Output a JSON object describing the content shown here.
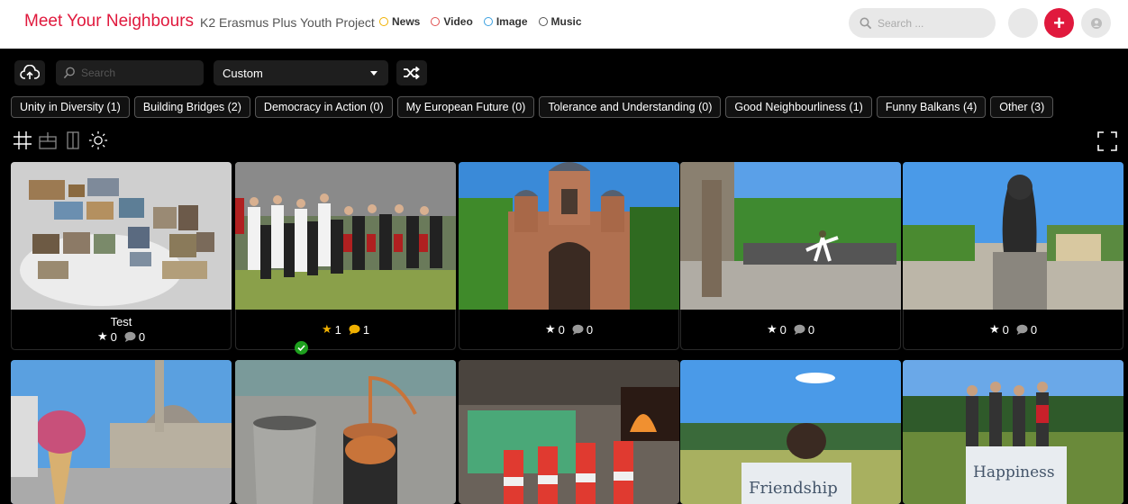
{
  "header": {
    "brand": "Meet Your Neighbours",
    "subtitle": "K2 Erasmus Plus Youth Project",
    "filters": [
      {
        "label": "News",
        "color": "#f0b000"
      },
      {
        "label": "Video",
        "color": "#e05050"
      },
      {
        "label": "Image",
        "color": "#3aa0e0"
      },
      {
        "label": "Music",
        "color": "#555555"
      }
    ],
    "search_placeholder": "Search ...",
    "add_icon": "plus-icon",
    "accent": "#e0193d"
  },
  "toolbar": {
    "search_placeholder": "Search",
    "sort_value": "Custom"
  },
  "categories": [
    "Unity in Diversity (1)",
    "Building Bridges (2)",
    "Democracy in Action (0)",
    "My European Future (0)",
    "Tolerance and Understanding (0)",
    "Good Neighbourliness (1)",
    "Funny Balkans (4)",
    "Other (3)"
  ],
  "cards": [
    {
      "title": "Test",
      "stars": "0",
      "comments": "0",
      "scene": "wall-of-photos"
    },
    {
      "title": "",
      "stars": "1",
      "comments": "1",
      "scene": "folk-dance",
      "approved": true
    },
    {
      "title": "",
      "stars": "0",
      "comments": "0",
      "scene": "church"
    },
    {
      "title": "",
      "stars": "0",
      "comments": "0",
      "scene": "park-dancer"
    },
    {
      "title": "",
      "stars": "0",
      "comments": "0",
      "scene": "lion-statue"
    },
    {
      "scene": "ice-cream-mosque"
    },
    {
      "scene": "copper-still"
    },
    {
      "scene": "bottles-fire"
    },
    {
      "scene": "friendship-sign"
    },
    {
      "scene": "happiness-sign"
    }
  ]
}
